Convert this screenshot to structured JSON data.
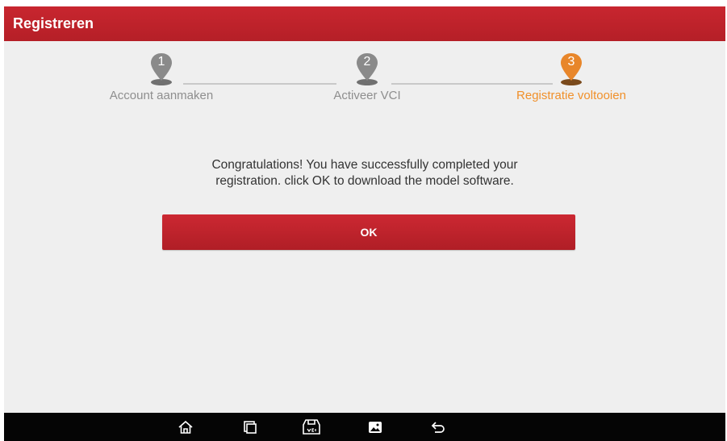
{
  "header": {
    "title": "Registreren"
  },
  "stepper": {
    "steps": [
      {
        "number": "1",
        "label": "Account aanmaken",
        "state": "done"
      },
      {
        "number": "2",
        "label": "Activeer VCI",
        "state": "done"
      },
      {
        "number": "3",
        "label": "Registratie voltooien",
        "state": "active"
      }
    ],
    "colors": {
      "inactive_pin": "#707070",
      "active_pin": "#e8862a",
      "inactive_text": "#8e8e8e",
      "active_text": "#f0902a"
    }
  },
  "message": {
    "line1": "Congratulations! You have successfully completed your",
    "line2": "registration. click OK to download the model software."
  },
  "actions": {
    "ok_label": "OK"
  },
  "navbar": {
    "icons": [
      "home-icon",
      "recent-apps-icon",
      "vci-icon",
      "screenshot-icon",
      "back-icon"
    ]
  },
  "theme": {
    "brand_red": "#c0222b",
    "background": "#efefef"
  }
}
